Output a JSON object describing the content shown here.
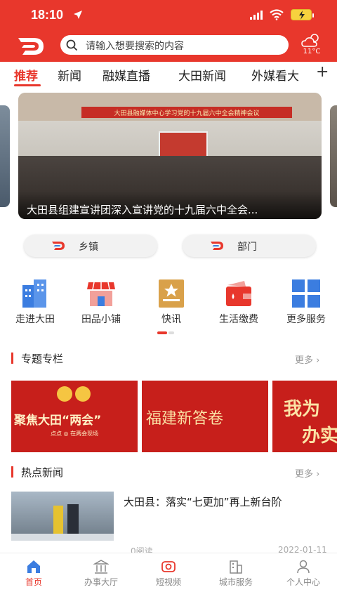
{
  "status_bar": {
    "time": "18:10"
  },
  "search": {
    "placeholder": "请输入想要搜索的内容"
  },
  "weather": {
    "temperature": "11°C"
  },
  "tabs": [
    {
      "label": "推荐",
      "active": true
    },
    {
      "label": "新闻"
    },
    {
      "label": "融媒直播"
    },
    {
      "label": "大田新闻"
    },
    {
      "label": "外媒看大"
    }
  ],
  "banner": {
    "sign_text": "大田县融媒体中心学习党的十九届六中全会精神会议",
    "caption": "大田县组建宣讲团深入宣讲党的十九届六中全会..."
  },
  "sub_buttons": [
    {
      "label": "乡镇"
    },
    {
      "label": "部门"
    }
  ],
  "shortcuts": [
    {
      "label": "走进大田",
      "icon": "building-icon",
      "color": "#3b7de0"
    },
    {
      "label": "田品小铺",
      "icon": "shop-icon",
      "color": "#e8372c"
    },
    {
      "label": "快讯",
      "icon": "star-news-icon",
      "color": "#e8372c"
    },
    {
      "label": "生活缴费",
      "icon": "wallet-icon",
      "color": "#e8372c"
    },
    {
      "label": "更多服务",
      "icon": "grid-apps-icon",
      "color": "#3b7de0"
    }
  ],
  "topics_section": {
    "title": "专题专栏",
    "more": "更多"
  },
  "topic_cards": [
    {
      "title": "聚焦大田“两会”",
      "subtitle": "点点 ◎ 在两会现场"
    },
    {
      "title": "福建新答卷"
    },
    {
      "title": "我为",
      "title2": "办实"
    }
  ],
  "hot_section": {
    "title": "热点新闻",
    "more": "更多"
  },
  "news": [
    {
      "title": "大田县：落实“七更加”再上新台阶",
      "views": "0阅读",
      "date": "2022-01-11"
    }
  ],
  "bottom_nav": [
    {
      "label": "首页",
      "icon": "home-icon",
      "active": true
    },
    {
      "label": "办事大厅",
      "icon": "government-hall-icon"
    },
    {
      "label": "短视频",
      "icon": "video-icon"
    },
    {
      "label": "城市服务",
      "icon": "city-service-icon"
    },
    {
      "label": "个人中心",
      "icon": "user-icon"
    }
  ],
  "colors": {
    "brand_red": "#e8372c",
    "accent_blue": "#3b7de0"
  }
}
